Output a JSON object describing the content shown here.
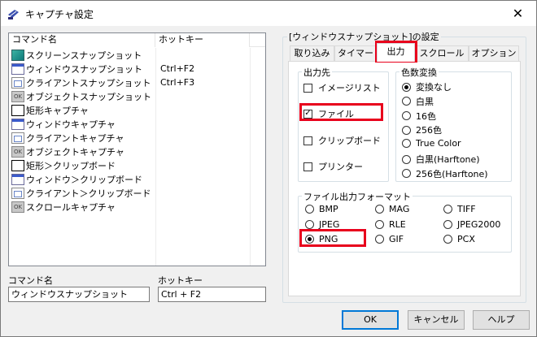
{
  "window": {
    "title": "キャプチャ設定",
    "close_glyph": "✕"
  },
  "list": {
    "headers": [
      "コマンド名",
      "ホットキー"
    ],
    "rows": [
      {
        "icon": "screen",
        "name": "スクリーンスナップショット",
        "hotkey": ""
      },
      {
        "icon": "window",
        "name": "ウィンドウスナップショット",
        "hotkey": "Ctrl+F2"
      },
      {
        "icon": "client",
        "name": "クライアントスナップショット",
        "hotkey": "Ctrl+F3"
      },
      {
        "icon": "obj",
        "name": "オブジェクトスナップショット",
        "hotkey": ""
      },
      {
        "icon": "rect",
        "name": "矩形キャプチャ",
        "hotkey": ""
      },
      {
        "icon": "window",
        "name": "ウィンドウキャプチャ",
        "hotkey": ""
      },
      {
        "icon": "client",
        "name": "クライアントキャプチャ",
        "hotkey": ""
      },
      {
        "icon": "obj",
        "name": "オブジェクトキャプチャ",
        "hotkey": ""
      },
      {
        "icon": "rect",
        "name": "矩形＞クリップボード",
        "hotkey": ""
      },
      {
        "icon": "window",
        "name": "ウィンドウ＞クリップボード",
        "hotkey": ""
      },
      {
        "icon": "client",
        "name": "クライアント＞クリップボード",
        "hotkey": ""
      },
      {
        "icon": "obj",
        "name": "スクロールキャプチャ",
        "hotkey": ""
      }
    ]
  },
  "fields": {
    "command_label": "コマンド名",
    "command_value": "ウィンドウスナップショット",
    "hotkey_label": "ホットキー",
    "hotkey_value": "Ctrl + F2"
  },
  "settings": {
    "group_title": "[ウィンドウスナップショット]の設定",
    "tabs": [
      "取り込み",
      "タイマー",
      "出力",
      "スクロール",
      "オプション"
    ],
    "active_tab": "出力",
    "output_dest": {
      "title": "出力先",
      "items": [
        {
          "label": "イメージリスト",
          "checked": false
        },
        {
          "label": "ファイル",
          "checked": true
        },
        {
          "label": "クリップボード",
          "checked": false
        },
        {
          "label": "プリンター",
          "checked": false
        }
      ]
    },
    "color_conv": {
      "title": "色数変換",
      "items": [
        {
          "label": "変換なし",
          "selected": true
        },
        {
          "label": "白黒",
          "selected": false
        },
        {
          "label": "16色",
          "selected": false
        },
        {
          "label": "256色",
          "selected": false
        },
        {
          "label": "True Color",
          "selected": false
        },
        {
          "label": "白黒(Harftone)",
          "selected": false
        },
        {
          "label": "256色(Harftone)",
          "selected": false
        }
      ]
    },
    "file_format": {
      "title": "ファイル出力フォーマット",
      "items": [
        {
          "label": "BMP",
          "selected": false
        },
        {
          "label": "MAG",
          "selected": false
        },
        {
          "label": "TIFF",
          "selected": false
        },
        {
          "label": "JPEG",
          "selected": false
        },
        {
          "label": "RLE",
          "selected": false
        },
        {
          "label": "JPEG2000",
          "selected": false
        },
        {
          "label": "PNG",
          "selected": true
        },
        {
          "label": "GIF",
          "selected": false
        },
        {
          "label": "PCX",
          "selected": false
        }
      ]
    }
  },
  "buttons": {
    "ok": "OK",
    "cancel": "キャンセル",
    "help": "ヘルプ"
  },
  "colors": {
    "highlight": "#e8001c",
    "default_button_border": "#0078d7"
  }
}
